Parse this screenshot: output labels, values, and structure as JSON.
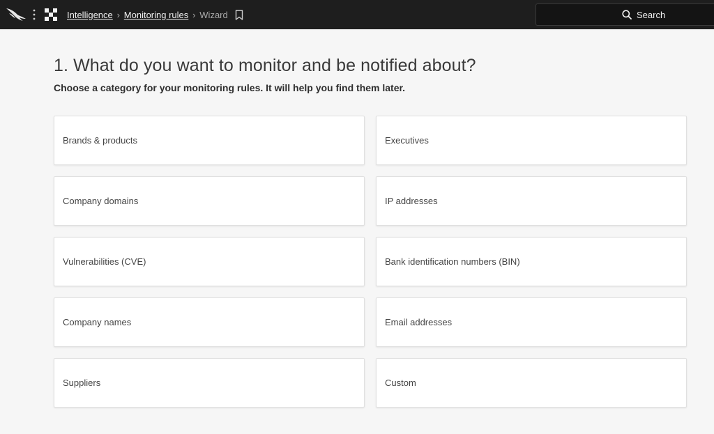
{
  "topbar": {
    "logo_icon": "falcon-logo-icon",
    "menu_icon": "kebab-menu-icon",
    "app_icon": "app-switcher-icon",
    "breadcrumb": {
      "item1": "Intelligence",
      "item2": "Monitoring rules",
      "current": "Wizard",
      "separator": "›"
    },
    "bookmark_icon": "bookmark-icon",
    "search_label": "Search",
    "colors": {
      "background": "#1e1e1e",
      "text": "#f0f0f0"
    }
  },
  "page": {
    "title": "1. What do you want to monitor and be notified about?",
    "subtitle": "Choose a category for your monitoring rules. It will help you find them later."
  },
  "categories": [
    "Brands & products",
    "Executives",
    "Company domains",
    "IP addresses",
    "Vulnerabilities (CVE)",
    "Bank identification numbers (BIN)",
    "Company names",
    "Email addresses",
    "Suppliers",
    "Custom"
  ]
}
